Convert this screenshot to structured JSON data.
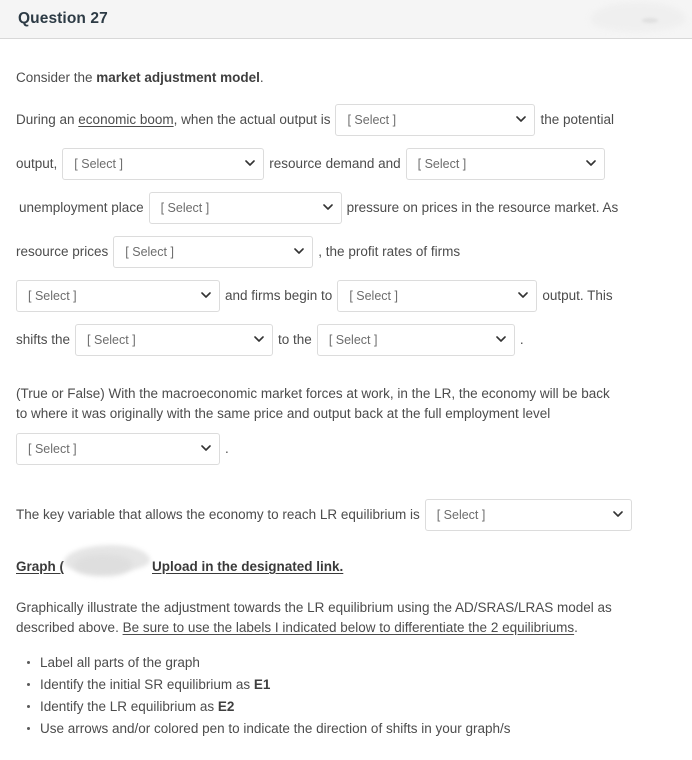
{
  "header": {
    "title": "Question 27"
  },
  "select_placeholder": "[ Select ]",
  "icons": {
    "chevron": "chevron-down-icon"
  },
  "colors": {
    "header_bg": "#f5f5f5",
    "header_text": "#2d3b45",
    "body_text": "#4c4c4c",
    "select_border": "#dcdcdc",
    "select_text": "#6d6d6d",
    "page_bg": "#ffffff"
  },
  "intro": {
    "prefix": "Consider the ",
    "bold": "market adjustment model",
    "suffix": "."
  },
  "sentence1": {
    "seg1": "During an ",
    "underlined": "economic boom",
    "seg2": ", when the actual output is",
    "select1": "[ Select ]",
    "seg3": "the potential",
    "seg4": "output,",
    "select2": "[ Select ]",
    "seg5": "resource demand and",
    "select3": "[ Select ]",
    "seg6": "unemployment place",
    "select4": "[ Select ]",
    "seg7": "pressure on prices in the resource market. As",
    "seg8": "resource prices",
    "select5": "[ Select ]",
    "seg9": ", the profit rates of firms",
    "select6": "[ Select ]",
    "seg10": "and firms begin to",
    "select7": "[ Select ]",
    "seg11": "output. This",
    "seg12": "shifts the",
    "select8": "[ Select ]",
    "seg13": "to the",
    "select9": "[ Select ]",
    "seg14": "."
  },
  "true_false": {
    "line1": "(True or False) With the macroeconomic market forces at work, in the LR, the economy will be back",
    "line2": "to where it was originally with the same price and output back at the full employment level",
    "select": "[ Select ]",
    "period": "."
  },
  "key_variable": {
    "text": "The key variable that allows the economy to reach LR equilibrium is",
    "select": "[ Select ]"
  },
  "graph_link": {
    "prefix": "Graph (",
    "redacted": "",
    "suffix": "Upload in the designated link."
  },
  "description": {
    "line1": "Graphically illustrate the adjustment towards the LR equilibrium using the AD/SRAS/LRAS model as",
    "line2_plain": "described above. ",
    "line2_underlined": "Be sure to use the labels I indicated below to differentiate the 2 equilibriums",
    "line2_end": "."
  },
  "bullets": [
    {
      "text": "Label all parts of the graph",
      "bold": "",
      "tail": ""
    },
    {
      "text": "Identify the initial SR equilibrium as ",
      "bold": "E1",
      "tail": ""
    },
    {
      "text": "Identify the LR equilibrium as ",
      "bold": "E2",
      "tail": ""
    },
    {
      "text": "Use arrows and/or colored pen to indicate the direction of shifts in your graph/s",
      "bold": "",
      "tail": ""
    }
  ]
}
